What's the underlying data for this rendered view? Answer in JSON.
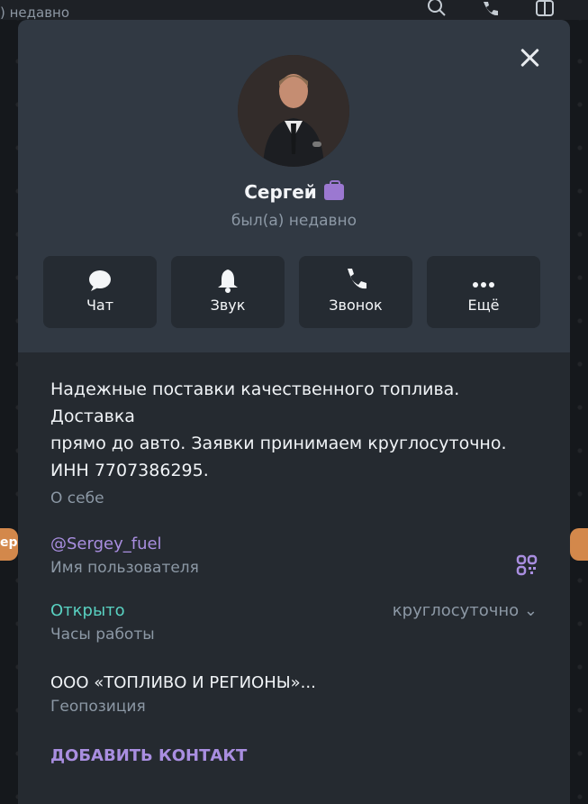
{
  "background": {
    "top_text": ") недавно",
    "left_tab_text": "ep"
  },
  "profile": {
    "name": "Сергей",
    "status": "был(а) недавно",
    "badge_icon": "briefcase-icon",
    "accent": "#9b78d1"
  },
  "actions": [
    {
      "label": "Чат",
      "icon": "chat-icon"
    },
    {
      "label": "Звук",
      "icon": "bell-icon"
    },
    {
      "label": "Звонок",
      "icon": "phone-icon"
    },
    {
      "label": "Ещё",
      "icon": "more-icon"
    }
  ],
  "about": {
    "text_line1": "Надежные поставки качественного топлива. Доставка",
    "text_line2": "прямо до авто. Заявки принимаем круглосуточно.",
    "text_line3": "ИНН 7707386295.",
    "label": "О себе"
  },
  "username": {
    "value": "@Sergey_fuel",
    "label": "Имя пользователя"
  },
  "hours": {
    "state": "Открыто",
    "value": "круглосуточно",
    "label": "Часы работы"
  },
  "location": {
    "value": "ООО «ТОПЛИВО И РЕГИОНЫ»...",
    "label": "Геопозиция"
  },
  "add_contact": "ДОБАВИТЬ КОНТАКТ",
  "colors": {
    "header": "#313943",
    "body": "#252a30",
    "link": "#a98ee0",
    "open": "#59d1c1"
  }
}
